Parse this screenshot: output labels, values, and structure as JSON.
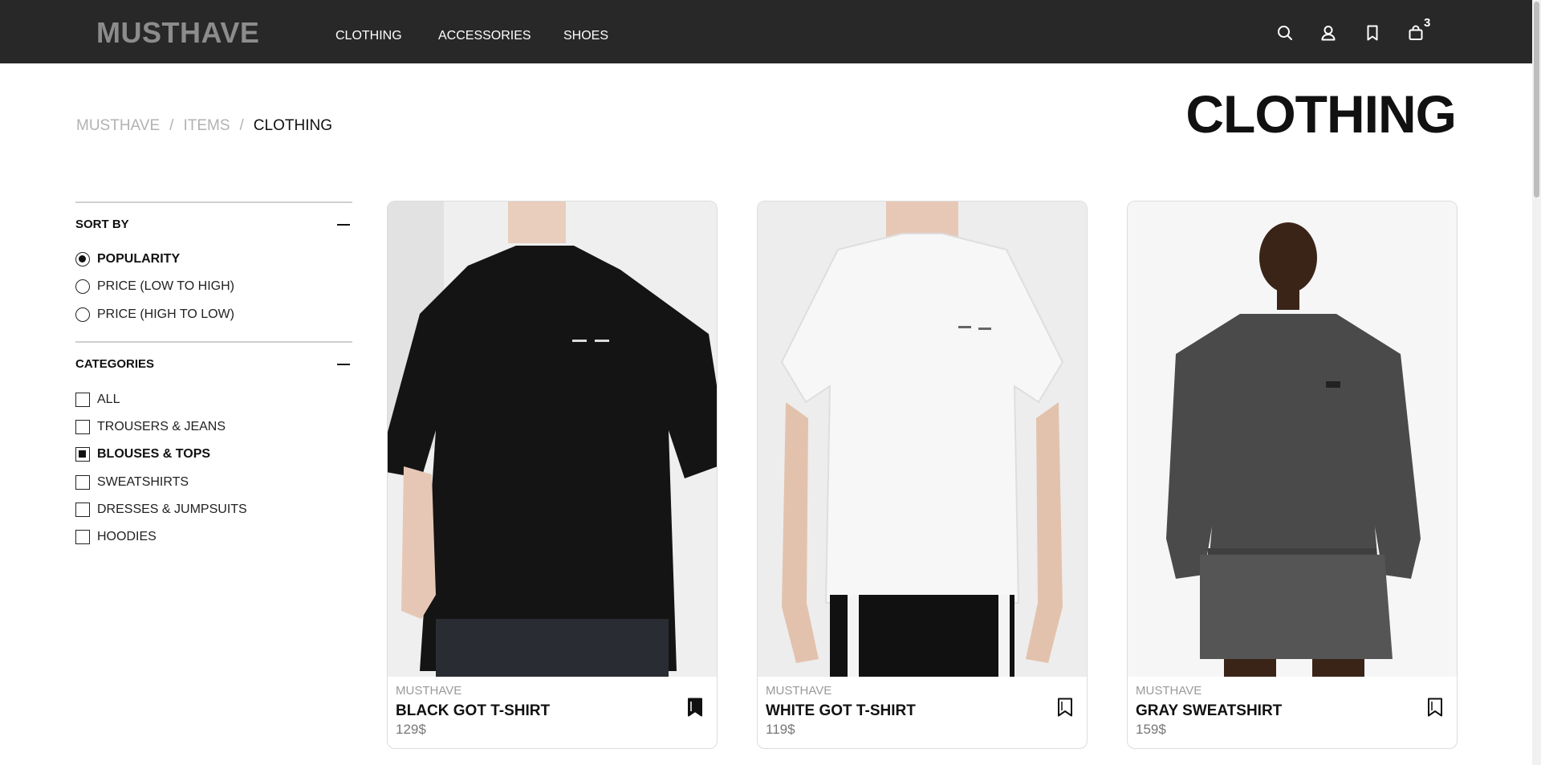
{
  "header": {
    "logo": "MUSTHAVE",
    "nav": [
      "CLOTHING",
      "ACCESSORIES",
      "SHOES"
    ],
    "icons": [
      "search-icon",
      "user-icon",
      "bookmark-icon",
      "shopping-bag-icon"
    ],
    "cart_count": "3"
  },
  "breadcrumb": {
    "items": [
      "MUSTHAVE",
      "ITEMS"
    ],
    "separator": "/",
    "current": "CLOTHING"
  },
  "page_title": "CLOTHING",
  "filters": {
    "sort": {
      "title": "SORT BY",
      "options": [
        "POPULARITY",
        "PRICE (LOW TO HIGH)",
        "PRICE (HIGH TO LOW)"
      ],
      "selected": "POPULARITY"
    },
    "categories": {
      "title": "CATEGORIES",
      "options": [
        "ALL",
        "TROUSERS & JEANS",
        "BLOUSES & TOPS",
        "SWEATSHIRTS",
        "DRESSES & JUMPSUITS",
        "HOODIES"
      ],
      "checked": [
        "BLOUSES & TOPS"
      ]
    }
  },
  "products": [
    {
      "brand": "MUSTHAVE",
      "name": "BLACK GOT T-SHIRT",
      "price": "129$",
      "bookmarked": true,
      "garment_color": "#141414"
    },
    {
      "brand": "MUSTHAVE",
      "name": "WHITE GOT T-SHIRT",
      "price": "119$",
      "bookmarked": false,
      "garment_color": "#f7f7f7"
    },
    {
      "brand": "MUSTHAVE",
      "name": "GRAY SWEATSHIRT",
      "price": "159$",
      "bookmarked": false,
      "garment_color": "#4a4a4a"
    }
  ],
  "colors": {
    "header_bg": "#282828",
    "logo": "#8c8c8c",
    "muted_text": "#b2b2b2"
  }
}
